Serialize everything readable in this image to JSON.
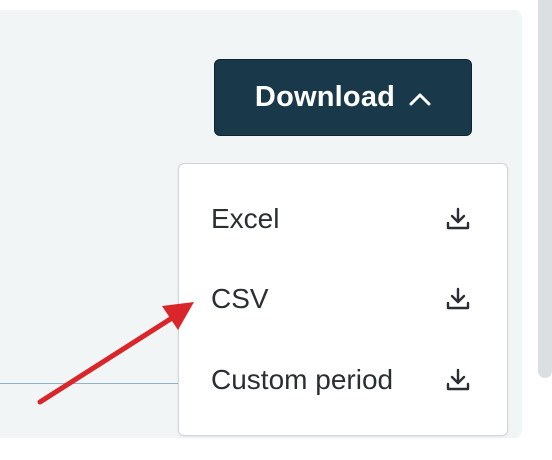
{
  "colors": {
    "panel_bg": "#f2f5f6",
    "button_bg": "#19394b",
    "button_text": "#ffffff",
    "menu_text": "#2b2f33",
    "annotation_arrow": "#d8262a",
    "divider": "#8fb3c3"
  },
  "download_button": {
    "label": "Download",
    "icon": "chevron-up-icon",
    "expanded": true
  },
  "download_menu": {
    "items": [
      {
        "label": "Excel",
        "icon": "download-icon"
      },
      {
        "label": "CSV",
        "icon": "download-icon"
      },
      {
        "label": "Custom period",
        "icon": "download-icon"
      }
    ]
  },
  "annotation": {
    "type": "arrow",
    "points_to": "CSV"
  }
}
